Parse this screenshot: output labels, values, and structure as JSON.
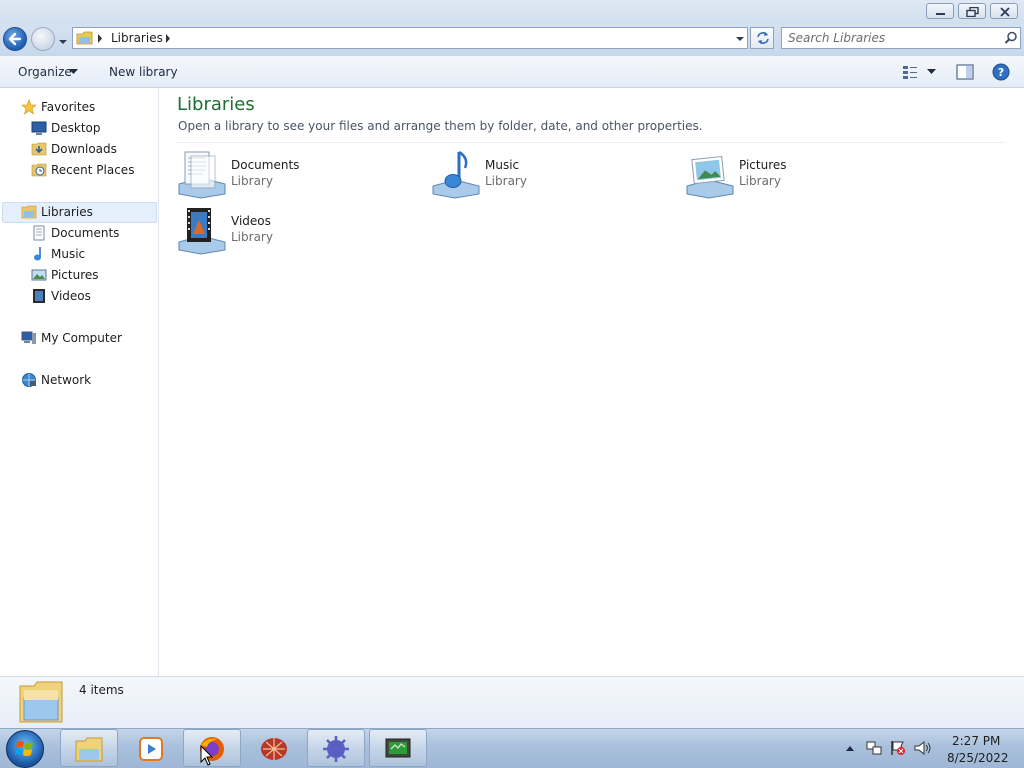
{
  "window": {
    "title_buttons": [
      "minimize-icon",
      "restore-icon",
      "close-icon"
    ]
  },
  "address_bar": {
    "path": "Libraries",
    "search_placeholder": "Search Libraries"
  },
  "toolbar": {
    "organize_label": "Organize",
    "new_library_label": "New library",
    "view_icon": "view-options-icon",
    "preview_pane_icon": "preview-pane-icon",
    "help_icon": "help-icon"
  },
  "nav": {
    "favorites": {
      "label": "Favorites",
      "items": [
        {
          "label": "Desktop",
          "icon": "desktop-icon"
        },
        {
          "label": "Downloads",
          "icon": "downloads-icon"
        },
        {
          "label": "Recent Places",
          "icon": "recent-places-icon"
        }
      ]
    },
    "libraries": {
      "label": "Libraries",
      "items": [
        {
          "label": "Documents",
          "icon": "documents-icon"
        },
        {
          "label": "Music",
          "icon": "music-icon"
        },
        {
          "label": "Pictures",
          "icon": "pictures-icon"
        },
        {
          "label": "Videos",
          "icon": "videos-icon"
        }
      ]
    },
    "computer": {
      "label": "My Computer"
    },
    "network": {
      "label": "Network"
    }
  },
  "main": {
    "title": "Libraries",
    "subtitle": "Open a library to see your files and arrange them by folder, date, and other properties.",
    "libraries": [
      {
        "name": "Documents",
        "type": "Library",
        "icon": "documents-library-icon"
      },
      {
        "name": "Music",
        "type": "Library",
        "icon": "music-library-icon"
      },
      {
        "name": "Pictures",
        "type": "Library",
        "icon": "pictures-library-icon"
      },
      {
        "name": "Videos",
        "type": "Library",
        "icon": "videos-library-icon"
      }
    ]
  },
  "details": {
    "item_count": "4 items"
  },
  "taskbar": {
    "apps": [
      "explorer-icon",
      "media-player-icon",
      "firefox-icon",
      "app-red-icon",
      "app-virus-icon",
      "app-monitor-icon"
    ],
    "clock_time": "2:27 PM",
    "clock_date": "8/25/2022"
  },
  "colors": {
    "title_green": "#1e6e31",
    "selection": "#e5eefb",
    "taskbar": "#a9c0dc"
  }
}
